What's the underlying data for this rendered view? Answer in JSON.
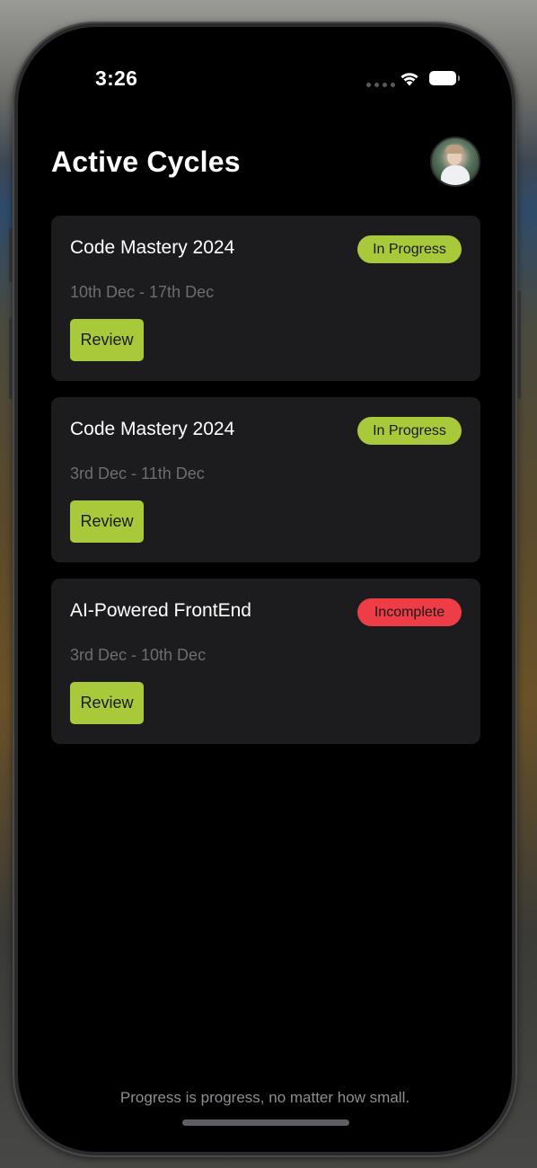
{
  "status_bar": {
    "time": "3:26",
    "icons": [
      "cellular-signal-icon",
      "wifi-icon",
      "battery-icon"
    ]
  },
  "header": {
    "title": "Active Cycles",
    "avatar": "profile-avatar"
  },
  "cycles": [
    {
      "title": "Code Mastery 2024",
      "dates": "10th Dec - 17th Dec",
      "status": "In Progress",
      "status_color": "#a7c93a",
      "action_label": "Review"
    },
    {
      "title": "Code Mastery 2024",
      "dates": "3rd Dec - 11th Dec",
      "status": "In Progress",
      "status_color": "#a7c93a",
      "action_label": "Review"
    },
    {
      "title": "AI-Powered FrontEnd",
      "dates": "3rd Dec - 10th Dec",
      "status": "Incomplete",
      "status_color": "#ee3d47",
      "action_label": "Review"
    }
  ],
  "footer": {
    "quote": "Progress is progress, no matter how small."
  },
  "colors": {
    "accent": "#a7c93a",
    "danger": "#ee3d47",
    "card_background": "#1c1c1e",
    "screen_background": "#000000"
  }
}
